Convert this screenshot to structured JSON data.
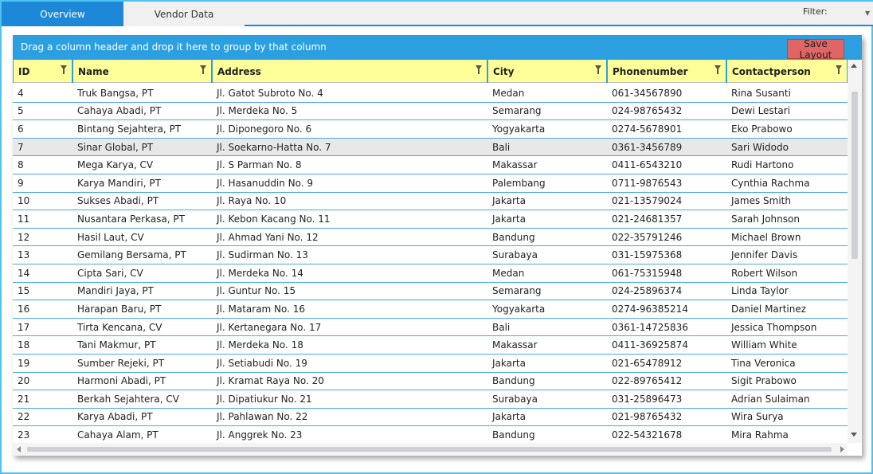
{
  "tabs": [
    {
      "label": "Overview",
      "active": true
    },
    {
      "label": "Vendor Data",
      "active": false
    }
  ],
  "filter": {
    "label": "Filter:",
    "value": ""
  },
  "group_bar": {
    "hint": "Drag a column header and drop it here to group by that column"
  },
  "save_layout_label": "Save Layout",
  "colors": {
    "accent": "#1e88d8",
    "header_bg": "#ffff99",
    "save_button": "#e06666",
    "group_bar": "#2b9fe0"
  },
  "columns": [
    "ID",
    "Name",
    "Address",
    "City",
    "Phonenumber",
    "Contactperson"
  ],
  "rows": [
    [
      "4",
      "Truk Bangsa, PT",
      "Jl. Gatot Subroto No. 4",
      "Medan",
      "061-34567890",
      "Rina Susanti"
    ],
    [
      "5",
      "Cahaya Abadi, PT",
      "Jl. Merdeka No. 5",
      "Semarang",
      "024-98765432",
      "Dewi Lestari"
    ],
    [
      "6",
      "Bintang Sejahtera, PT",
      "Jl. Diponegoro No. 6",
      "Yogyakarta",
      "0274-5678901",
      "Eko Prabowo"
    ],
    [
      "7",
      "Sinar Global, PT",
      "Jl. Soekarno-Hatta No. 7",
      "Bali",
      "0361-3456789",
      "Sari Widodo"
    ],
    [
      "8",
      "Mega Karya, CV",
      "Jl. S Parman No. 8",
      "Makassar",
      "0411-6543210",
      "Rudi Hartono"
    ],
    [
      "9",
      "Karya Mandiri, PT",
      "Jl. Hasanuddin No. 9",
      "Palembang",
      "0711-9876543",
      "Cynthia Rachma"
    ],
    [
      "10",
      "Sukses Abadi, PT",
      "Jl. Raya No. 10",
      "Jakarta",
      "021-13579024",
      "James Smith"
    ],
    [
      "11",
      "Nusantara Perkasa, PT",
      "Jl. Kebon Kacang No. 11",
      "Jakarta",
      "021-24681357",
      "Sarah Johnson"
    ],
    [
      "12",
      "Hasil Laut, CV",
      "Jl. Ahmad Yani No. 12",
      "Bandung",
      "022-35791246",
      "Michael Brown"
    ],
    [
      "13",
      "Gemilang Bersama, PT",
      "Jl. Sudirman No. 13",
      "Surabaya",
      "031-15975368",
      "Jennifer Davis"
    ],
    [
      "14",
      "Cipta Sari, CV",
      "Jl. Merdeka No. 14",
      "Medan",
      "061-75315948",
      "Robert Wilson"
    ],
    [
      "15",
      "Mandiri Jaya, PT",
      "Jl. Guntur No. 15",
      "Semarang",
      "024-25896374",
      "Linda Taylor"
    ],
    [
      "16",
      "Harapan Baru, PT",
      "Jl. Mataram No. 16",
      "Yogyakarta",
      "0274-96385214",
      "Daniel Martinez"
    ],
    [
      "17",
      "Tirta Kencana, CV",
      "Jl. Kertanegara No. 17",
      "Bali",
      "0361-14725836",
      "Jessica Thompson"
    ],
    [
      "18",
      "Tani Makmur, PT",
      "Jl. Merdeka No. 18",
      "Makassar",
      "0411-36925874",
      "William White"
    ],
    [
      "19",
      "Sumber Rejeki, PT",
      "Jl. Setiabudi No. 19",
      "Jakarta",
      "021-65478912",
      "Tina Veronica"
    ],
    [
      "20",
      "Harmoni Abadi, PT",
      "Jl. Kramat Raya No. 20",
      "Bandung",
      "022-89765412",
      "Sigit Prabowo"
    ],
    [
      "21",
      "Berkah Sejahtera, CV",
      "Jl. Dipatiukur No. 21",
      "Surabaya",
      "031-25896473",
      "Adrian Sulaiman"
    ],
    [
      "22",
      "Karya Abadi, PT",
      "Jl. Pahlawan No. 22",
      "Jakarta",
      "021-98765432",
      "Wira Surya"
    ],
    [
      "23",
      "Cahaya Alam, PT",
      "Jl. Anggrek No. 23",
      "Bandung",
      "022-54321678",
      "Mira Rahma"
    ]
  ],
  "selected_row_id": "7"
}
